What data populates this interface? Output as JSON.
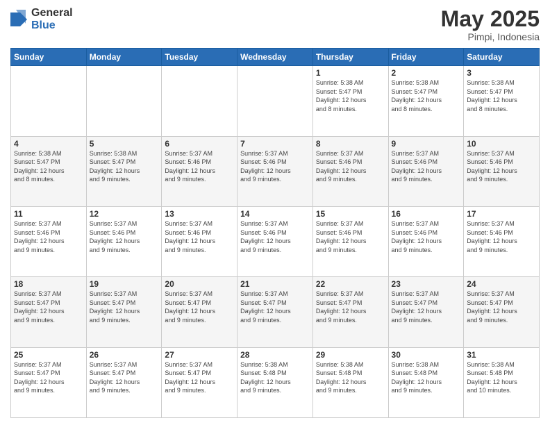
{
  "logo": {
    "general": "General",
    "blue": "Blue"
  },
  "title": {
    "month": "May 2025",
    "location": "Pimpi, Indonesia"
  },
  "days_of_week": [
    "Sunday",
    "Monday",
    "Tuesday",
    "Wednesday",
    "Thursday",
    "Friday",
    "Saturday"
  ],
  "weeks": [
    [
      {
        "day": "",
        "info": ""
      },
      {
        "day": "",
        "info": ""
      },
      {
        "day": "",
        "info": ""
      },
      {
        "day": "",
        "info": ""
      },
      {
        "day": "1",
        "info": "Sunrise: 5:38 AM\nSunset: 5:47 PM\nDaylight: 12 hours\nand 8 minutes."
      },
      {
        "day": "2",
        "info": "Sunrise: 5:38 AM\nSunset: 5:47 PM\nDaylight: 12 hours\nand 8 minutes."
      },
      {
        "day": "3",
        "info": "Sunrise: 5:38 AM\nSunset: 5:47 PM\nDaylight: 12 hours\nand 8 minutes."
      }
    ],
    [
      {
        "day": "4",
        "info": "Sunrise: 5:38 AM\nSunset: 5:47 PM\nDaylight: 12 hours\nand 8 minutes."
      },
      {
        "day": "5",
        "info": "Sunrise: 5:38 AM\nSunset: 5:47 PM\nDaylight: 12 hours\nand 9 minutes."
      },
      {
        "day": "6",
        "info": "Sunrise: 5:37 AM\nSunset: 5:46 PM\nDaylight: 12 hours\nand 9 minutes."
      },
      {
        "day": "7",
        "info": "Sunrise: 5:37 AM\nSunset: 5:46 PM\nDaylight: 12 hours\nand 9 minutes."
      },
      {
        "day": "8",
        "info": "Sunrise: 5:37 AM\nSunset: 5:46 PM\nDaylight: 12 hours\nand 9 minutes."
      },
      {
        "day": "9",
        "info": "Sunrise: 5:37 AM\nSunset: 5:46 PM\nDaylight: 12 hours\nand 9 minutes."
      },
      {
        "day": "10",
        "info": "Sunrise: 5:37 AM\nSunset: 5:46 PM\nDaylight: 12 hours\nand 9 minutes."
      }
    ],
    [
      {
        "day": "11",
        "info": "Sunrise: 5:37 AM\nSunset: 5:46 PM\nDaylight: 12 hours\nand 9 minutes."
      },
      {
        "day": "12",
        "info": "Sunrise: 5:37 AM\nSunset: 5:46 PM\nDaylight: 12 hours\nand 9 minutes."
      },
      {
        "day": "13",
        "info": "Sunrise: 5:37 AM\nSunset: 5:46 PM\nDaylight: 12 hours\nand 9 minutes."
      },
      {
        "day": "14",
        "info": "Sunrise: 5:37 AM\nSunset: 5:46 PM\nDaylight: 12 hours\nand 9 minutes."
      },
      {
        "day": "15",
        "info": "Sunrise: 5:37 AM\nSunset: 5:46 PM\nDaylight: 12 hours\nand 9 minutes."
      },
      {
        "day": "16",
        "info": "Sunrise: 5:37 AM\nSunset: 5:46 PM\nDaylight: 12 hours\nand 9 minutes."
      },
      {
        "day": "17",
        "info": "Sunrise: 5:37 AM\nSunset: 5:46 PM\nDaylight: 12 hours\nand 9 minutes."
      }
    ],
    [
      {
        "day": "18",
        "info": "Sunrise: 5:37 AM\nSunset: 5:47 PM\nDaylight: 12 hours\nand 9 minutes."
      },
      {
        "day": "19",
        "info": "Sunrise: 5:37 AM\nSunset: 5:47 PM\nDaylight: 12 hours\nand 9 minutes."
      },
      {
        "day": "20",
        "info": "Sunrise: 5:37 AM\nSunset: 5:47 PM\nDaylight: 12 hours\nand 9 minutes."
      },
      {
        "day": "21",
        "info": "Sunrise: 5:37 AM\nSunset: 5:47 PM\nDaylight: 12 hours\nand 9 minutes."
      },
      {
        "day": "22",
        "info": "Sunrise: 5:37 AM\nSunset: 5:47 PM\nDaylight: 12 hours\nand 9 minutes."
      },
      {
        "day": "23",
        "info": "Sunrise: 5:37 AM\nSunset: 5:47 PM\nDaylight: 12 hours\nand 9 minutes."
      },
      {
        "day": "24",
        "info": "Sunrise: 5:37 AM\nSunset: 5:47 PM\nDaylight: 12 hours\nand 9 minutes."
      }
    ],
    [
      {
        "day": "25",
        "info": "Sunrise: 5:37 AM\nSunset: 5:47 PM\nDaylight: 12 hours\nand 9 minutes."
      },
      {
        "day": "26",
        "info": "Sunrise: 5:37 AM\nSunset: 5:47 PM\nDaylight: 12 hours\nand 9 minutes."
      },
      {
        "day": "27",
        "info": "Sunrise: 5:37 AM\nSunset: 5:47 PM\nDaylight: 12 hours\nand 9 minutes."
      },
      {
        "day": "28",
        "info": "Sunrise: 5:38 AM\nSunset: 5:48 PM\nDaylight: 12 hours\nand 9 minutes."
      },
      {
        "day": "29",
        "info": "Sunrise: 5:38 AM\nSunset: 5:48 PM\nDaylight: 12 hours\nand 9 minutes."
      },
      {
        "day": "30",
        "info": "Sunrise: 5:38 AM\nSunset: 5:48 PM\nDaylight: 12 hours\nand 9 minutes."
      },
      {
        "day": "31",
        "info": "Sunrise: 5:38 AM\nSunset: 5:48 PM\nDaylight: 12 hours\nand 10 minutes."
      }
    ]
  ]
}
